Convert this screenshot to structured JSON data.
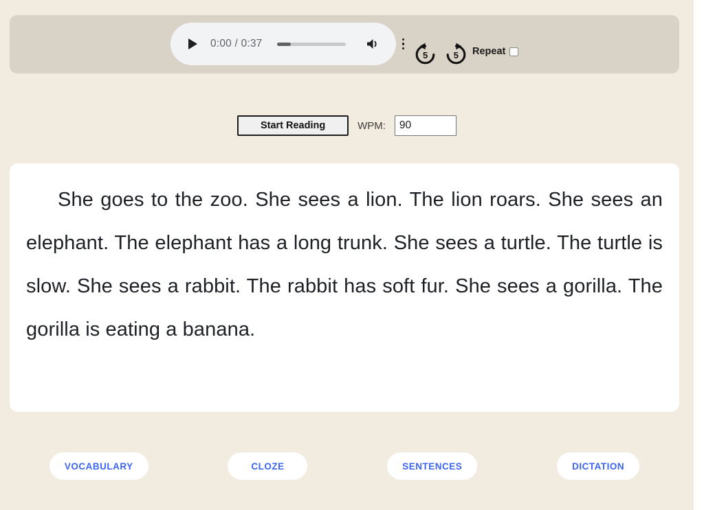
{
  "theme": {
    "page_bg": "#f2ebdf",
    "audio_panel_bg": "#d9d2c6",
    "card_bg": "#ffffff",
    "action_accent": "#3b65f0",
    "text_color": "#1c2024"
  },
  "audio_player": {
    "play_icon": "play-icon",
    "time_display": "0:00 / 0:37",
    "current_time": "0:00",
    "duration": "0:37",
    "progress_percent": 20,
    "volume_icon": "speaker-icon",
    "more_options_icon": "kebab-menu-icon",
    "seek_back_label": "5",
    "seek_back_icon": "replay-5-icon",
    "seek_forward_label": "5",
    "seek_forward_icon": "forward-5-icon",
    "repeat_label": "Repeat",
    "repeat_checked": false
  },
  "controls": {
    "start_reading_label": "Start Reading",
    "wpm_label": "WPM:",
    "wpm_value": "90",
    "wpm_placeholder": "90"
  },
  "reading": {
    "passage": "She goes to the zoo. She sees a lion. The lion roars. She sees an elephant. The elephant has a long trunk. She sees a turtle. The turtle is slow. She sees a rabbit. The rabbit has soft fur. She sees a gorilla. The gorilla is eating a banana."
  },
  "actions": [
    {
      "label": "VOCABULARY",
      "name": "vocabulary-button"
    },
    {
      "label": "CLOZE",
      "name": "cloze-button"
    },
    {
      "label": "SENTENCES",
      "name": "sentences-button"
    },
    {
      "label": "DICTATION",
      "name": "dictation-button"
    }
  ]
}
